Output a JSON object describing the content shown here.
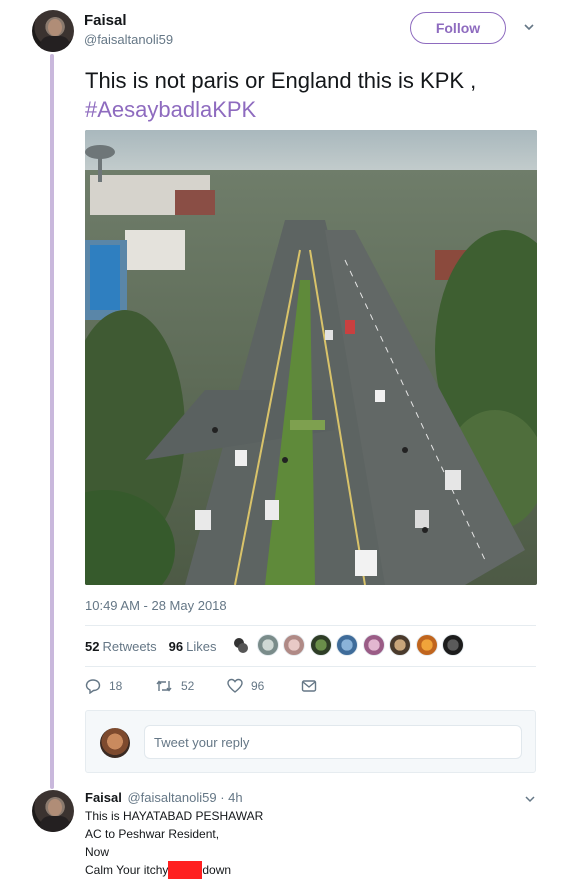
{
  "tweet": {
    "display_name": "Faisal",
    "handle": "@faisaltanoli59",
    "follow_label": "Follow",
    "text": "This is not paris or England this is KPK ,",
    "hashtag": "#AesaybadlaKPK",
    "timestamp": "10:49 AM - 28 May 2018",
    "photo_icon": "city-road-aerial-photo",
    "retweets_count": "52",
    "retweets_label": "Retweets",
    "likes_count": "96",
    "likes_label": "Likes",
    "liker_avatar_count_shown": 9,
    "actions": {
      "reply_count": "18",
      "retweet_count": "52",
      "like_count": "96"
    }
  },
  "reply_box": {
    "placeholder": "Tweet your reply"
  },
  "reply": {
    "display_name": "Faisal",
    "handle": "@faisaltanoli59",
    "separator": "·",
    "age": "4h",
    "lines": [
      "This is HAYATABAD PESHAWAR",
      "AC to Peshwar Resident,",
      "Now",
      "Calm Your itchy"
    ],
    "line_end": "down"
  },
  "colors": {
    "accent": "#8e6bbf",
    "thread_line": "#c9b8dc",
    "muted": "#657786",
    "redaction": "#ff2020"
  }
}
